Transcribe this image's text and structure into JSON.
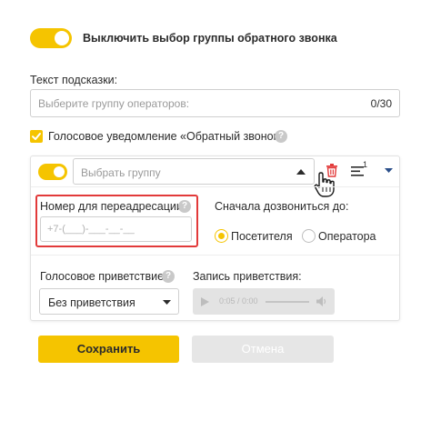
{
  "callback_toggle": {
    "label": "Выключить выбор группы обратного звонка"
  },
  "hint": {
    "label": "Текст подсказки:",
    "placeholder": "Выберите группу операторов:",
    "counter": "0/30"
  },
  "voice_notification": {
    "label": "Голосовое уведомление «Обратный звонок»",
    "help": "?"
  },
  "group": {
    "select_placeholder": "Выбрать группу",
    "count_badge": "1"
  },
  "redirect": {
    "label": "Номер для переадресации:",
    "help": "?",
    "phone_placeholder": "+7-(___)-___-__-__"
  },
  "call_first": {
    "label": "Сначала дозвониться до:",
    "options": [
      "Посетителя",
      "Оператора"
    ],
    "selected": "Посетителя"
  },
  "greeting": {
    "label": "Голосовое приветствие:",
    "help": "?",
    "selected": "Без приветствия"
  },
  "recording": {
    "label": "Запись приветствия:",
    "time": "0:05 / 0:00"
  },
  "actions": {
    "save": "Сохранить",
    "cancel": "Отмена"
  },
  "colors": {
    "accent": "#f5c400",
    "danger": "#e23a3a",
    "muted": "#9a9a9a"
  }
}
